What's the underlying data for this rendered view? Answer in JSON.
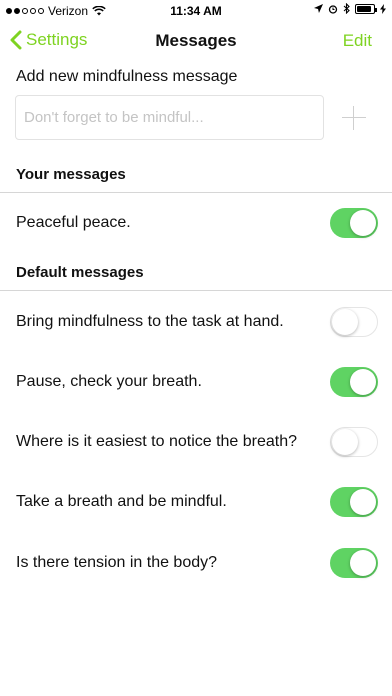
{
  "status_bar": {
    "carrier": "Verizon",
    "time": "11:34 AM"
  },
  "nav": {
    "back_label": "Settings",
    "title": "Messages",
    "edit_label": "Edit"
  },
  "add": {
    "label": "Add new mindfulness message",
    "placeholder": "Don't forget to be mindful..."
  },
  "your_messages": {
    "header": "Your messages",
    "items": [
      {
        "label": "Peaceful peace.",
        "enabled": true
      }
    ]
  },
  "default_messages": {
    "header": "Default messages",
    "items": [
      {
        "label": "Bring mindfulness to the task at hand.",
        "enabled": false
      },
      {
        "label": "Pause, check your breath.",
        "enabled": true
      },
      {
        "label": "Where is it easiest to notice the breath?",
        "enabled": false
      },
      {
        "label": "Take a breath and be mindful.",
        "enabled": true
      },
      {
        "label": "Is there tension in the body?",
        "enabled": true
      }
    ]
  },
  "colors": {
    "accent": "#7ed321",
    "toggle_on": "#5fd363"
  }
}
